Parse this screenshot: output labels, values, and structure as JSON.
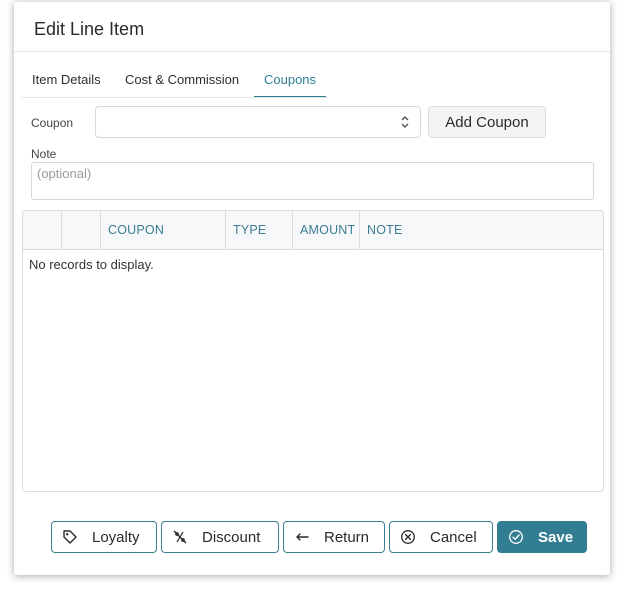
{
  "dialog": {
    "title": "Edit Line Item"
  },
  "tabs": [
    {
      "label": "Item Details",
      "active": false
    },
    {
      "label": "Cost & Commission",
      "active": false
    },
    {
      "label": "Coupons",
      "active": true
    }
  ],
  "form": {
    "coupon_label": "Coupon",
    "coupon_value": "",
    "add_coupon_label": "Add Coupon",
    "note_label": "Note",
    "note_placeholder": "(optional)"
  },
  "grid": {
    "columns": [
      "",
      "",
      "COUPON",
      "TYPE",
      "AMOUNT",
      "NOTE"
    ],
    "empty_text": "No records to display."
  },
  "footer": {
    "loyalty_label": "Loyalty",
    "discount_label": "Discount",
    "return_label": "Return",
    "cancel_label": "Cancel",
    "save_label": "Save"
  },
  "colors": {
    "accent": "#337d93",
    "header_text": "#3d7c92"
  },
  "icons": {
    "loyalty": "tag-icon",
    "discount": "no-discount-icon",
    "return": "return-arrow-icon",
    "cancel": "close-circle-icon",
    "save": "check-circle-icon",
    "select": "chevron-updown-icon"
  }
}
